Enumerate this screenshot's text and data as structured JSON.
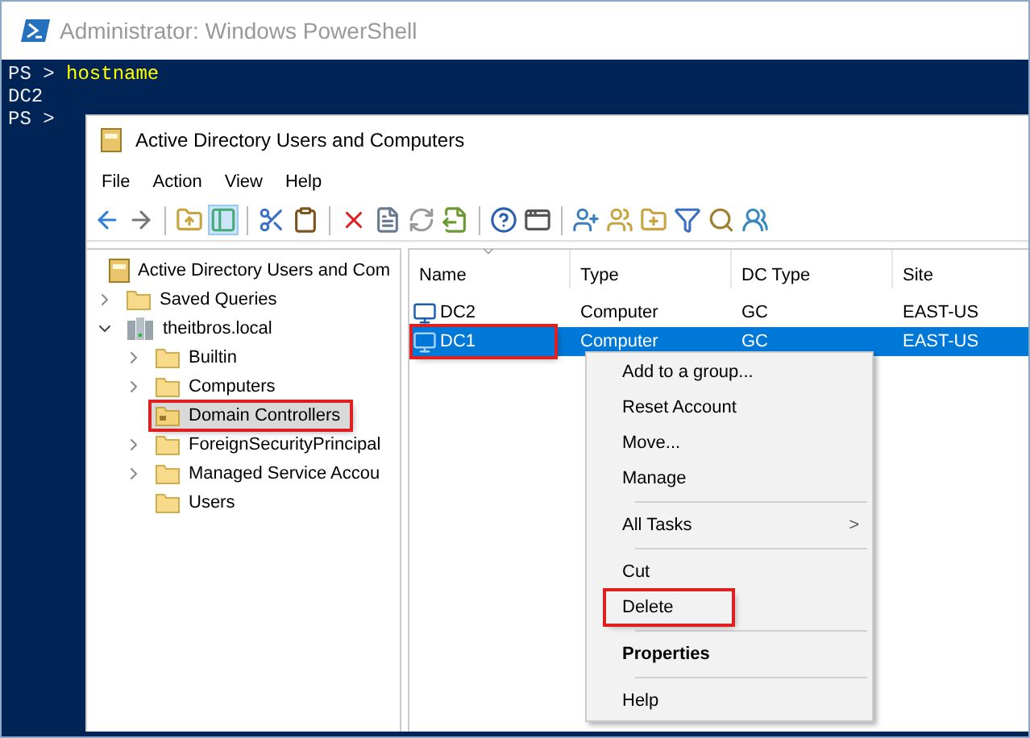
{
  "console": {
    "title": "Administrator: Windows PowerShell",
    "lines": [
      {
        "prompt": "PS > ",
        "command": "hostname"
      },
      {
        "output": "DC2"
      },
      {
        "prompt": "PS > "
      }
    ]
  },
  "window": {
    "title": "Active Directory Users and Computers"
  },
  "menu": [
    "File",
    "Action",
    "View",
    "Help"
  ],
  "tree": [
    {
      "label": "Active Directory Users and Com",
      "kind": "root",
      "selected": false,
      "highlighted": false,
      "children": [
        {
          "label": "Saved Queries",
          "kind": "folder",
          "expanded": false,
          "selected": false,
          "highlighted": false
        },
        {
          "label": "theitbros.local",
          "kind": "domain",
          "expanded": true,
          "selected": false,
          "highlighted": false,
          "children": [
            {
              "label": "Builtin",
              "kind": "folder",
              "expanded": false,
              "selected": false,
              "highlighted": false
            },
            {
              "label": "Computers",
              "kind": "folder",
              "expanded": false,
              "selected": false,
              "highlighted": false
            },
            {
              "label": "Domain Controllers",
              "kind": "ou",
              "selected": true,
              "highlighted": true
            },
            {
              "label": "ForeignSecurityPrincipal",
              "kind": "folder",
              "expanded": false,
              "selected": false,
              "highlighted": false
            },
            {
              "label": "Managed Service Accou",
              "kind": "folder",
              "expanded": false,
              "selected": false,
              "highlighted": false
            },
            {
              "label": "Users",
              "kind": "folder",
              "selected": false,
              "highlighted": false
            }
          ]
        }
      ]
    }
  ],
  "table": {
    "columns": [
      "Name",
      "Type",
      "DC Type",
      "Site"
    ],
    "rows": [
      {
        "cells": [
          "DC2",
          "Computer",
          "GC",
          "EAST-US"
        ],
        "selected": false,
        "highlighted": false
      },
      {
        "cells": [
          "DC1",
          "Computer",
          "GC",
          "EAST-US"
        ],
        "selected": true,
        "highlighted": true
      }
    ]
  },
  "context_menu": [
    {
      "kind": "item",
      "label": "Add to a group...",
      "bold": false,
      "highlighted": false
    },
    {
      "kind": "item",
      "label": "Reset Account",
      "bold": false,
      "highlighted": false
    },
    {
      "kind": "item",
      "label": "Move...",
      "bold": false,
      "highlighted": false
    },
    {
      "kind": "item",
      "label": "Manage",
      "bold": false,
      "highlighted": false
    },
    {
      "kind": "separator"
    },
    {
      "kind": "submenu",
      "label": "All Tasks",
      "arrow": ">",
      "bold": false,
      "highlighted": false
    },
    {
      "kind": "separator"
    },
    {
      "kind": "item",
      "label": "Cut",
      "bold": false,
      "highlighted": false
    },
    {
      "kind": "item",
      "label": "Delete",
      "bold": false,
      "highlighted": true
    },
    {
      "kind": "separator"
    },
    {
      "kind": "item",
      "label": "Properties",
      "bold": true,
      "highlighted": false
    },
    {
      "kind": "separator"
    },
    {
      "kind": "item",
      "label": "Help",
      "bold": false,
      "highlighted": false
    }
  ]
}
